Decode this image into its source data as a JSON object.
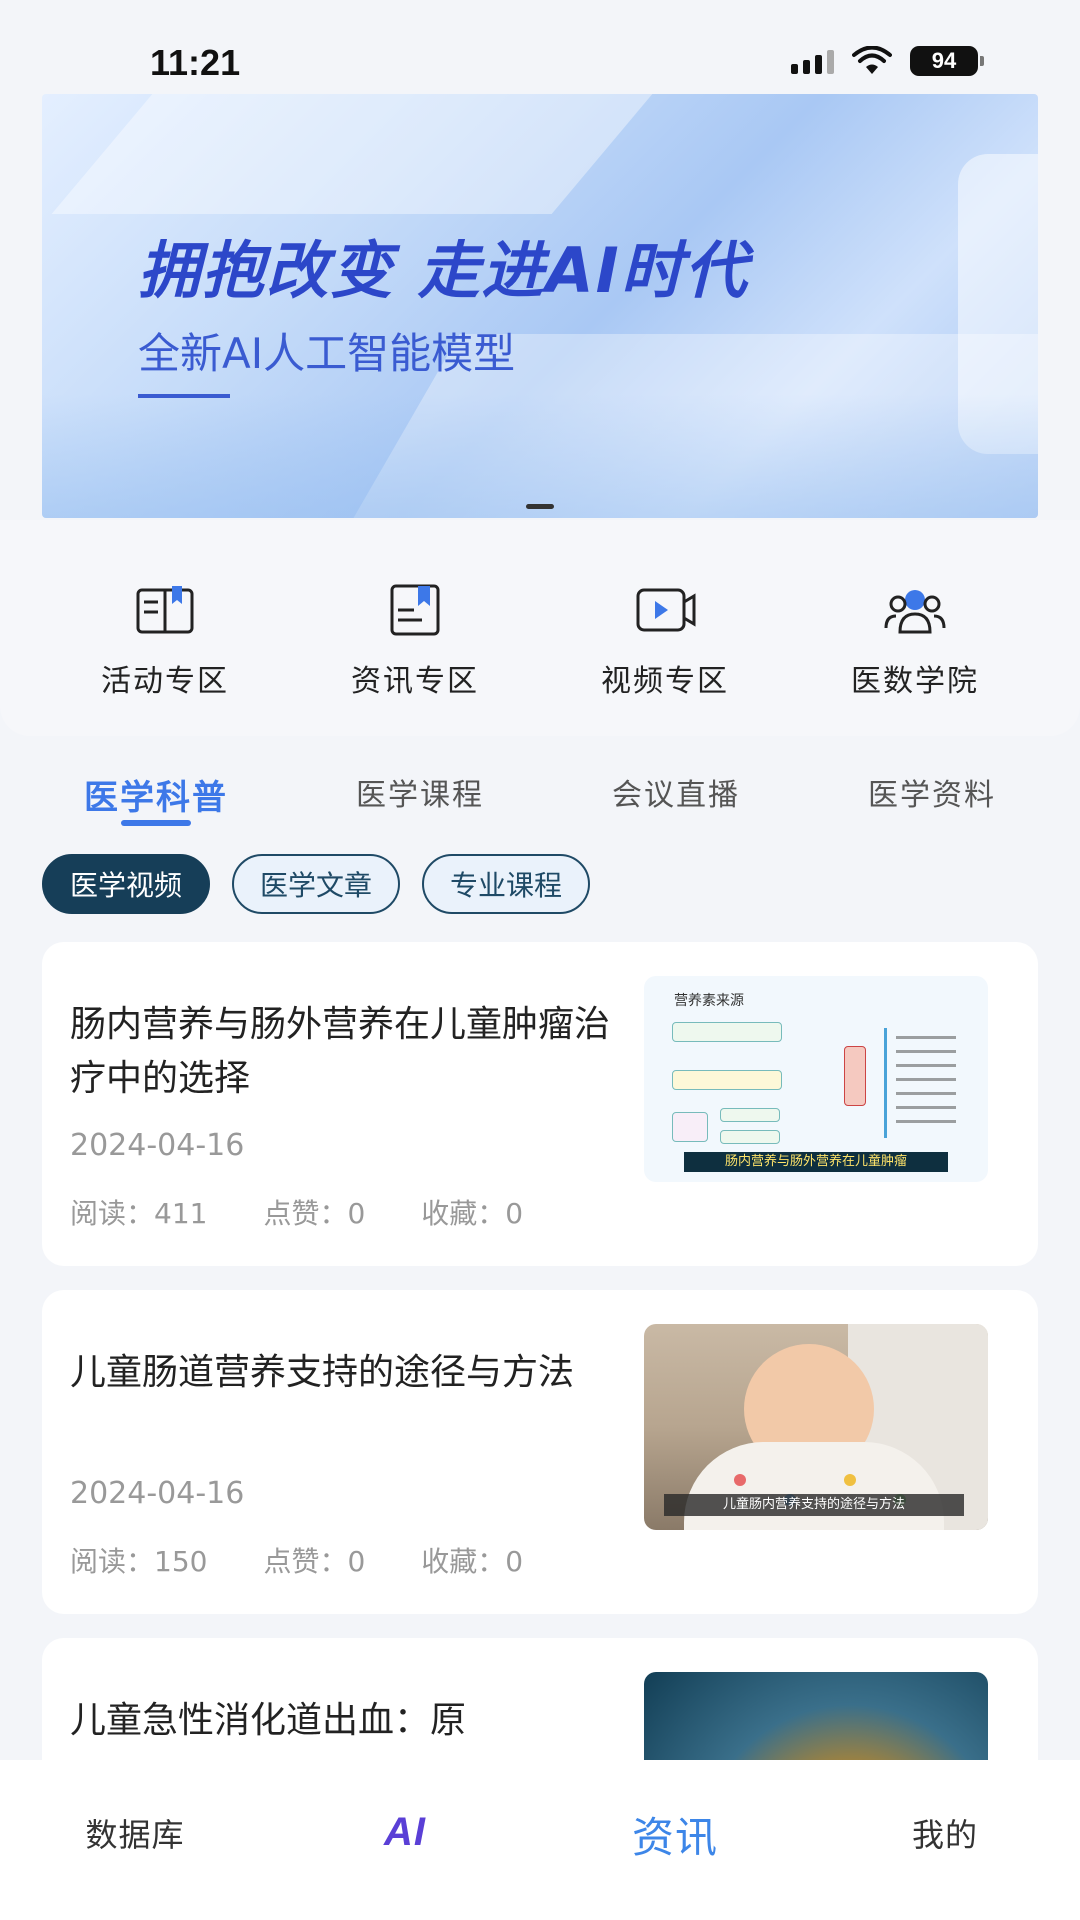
{
  "status_bar": {
    "time": "11:21",
    "battery": "94"
  },
  "banner": {
    "title": "拥抱改变 走进AI时代",
    "subtitle": "全新AI人工智能模型"
  },
  "shortcuts": [
    {
      "label": "活动专区",
      "icon": "open-book-icon"
    },
    {
      "label": "资讯专区",
      "icon": "bookmarked-book-icon"
    },
    {
      "label": "视频专区",
      "icon": "video-icon"
    },
    {
      "label": "医数学院",
      "icon": "group-icon"
    }
  ],
  "category_tabs": [
    "医学科普",
    "医学课程",
    "会议直播",
    "医学资料"
  ],
  "active_category": "医学科普",
  "chips": [
    "医学视频",
    "医学文章",
    "专业课程"
  ],
  "active_chip": "医学视频",
  "articles": [
    {
      "title": "肠内营养与肠外营养在儿童肿瘤治疗中的选择",
      "date": "2024-04-16",
      "reads": "阅读：411",
      "likes": "点赞：0",
      "favorites": "收藏：0",
      "thumb_header": "营养素来源",
      "thumb_caption": "肠内营养与肠外营养在儿童肿瘤"
    },
    {
      "title": "儿童肠道营养支持的途径与方法",
      "date": "2024-04-16",
      "reads": "阅读：150",
      "likes": "点赞：0",
      "favorites": "收藏：0",
      "thumb_caption": "儿童肠内营养支持的途径与方法"
    },
    {
      "title": "儿童急性消化道出血：原"
    }
  ],
  "bottom_nav": [
    "数据库",
    "AI",
    "资讯",
    "我的"
  ],
  "active_nav": "资讯",
  "colors": {
    "accent": "#3d78e8",
    "chip_dark": "#163e58",
    "banner_text": "#2c47c9"
  }
}
